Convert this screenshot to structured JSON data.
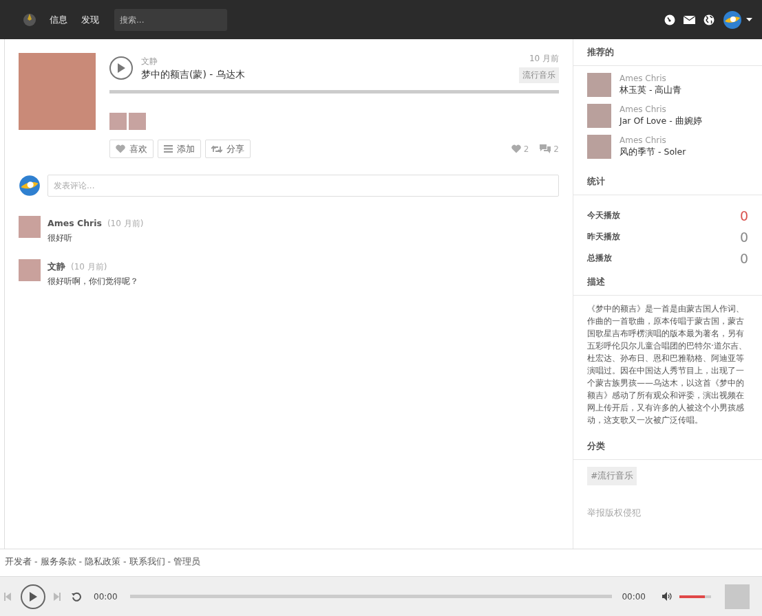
{
  "nav": {
    "items": [
      {
        "label": "信息"
      },
      {
        "label": "发现"
      }
    ],
    "search": {
      "placeholder": "搜索..."
    }
  },
  "track": {
    "artist": "文静",
    "title": "梦中的额吉(蒙) - 乌达木",
    "time": "10 月前",
    "genre": "流行音乐",
    "level": 0,
    "likers": [
      {
        "kind": "photo"
      },
      {
        "kind": "photo"
      }
    ],
    "actions": [
      {
        "kind": "like",
        "label": "喜欢"
      },
      {
        "kind": "add",
        "label": "添加"
      },
      {
        "kind": "share",
        "label": "分享"
      }
    ],
    "likes": "2",
    "comments": "2"
  },
  "comment_box": {
    "placeholder": "发表评论..."
  },
  "comments": [
    {
      "author": "Ames Chris",
      "time": "(10 月前)",
      "text": "很好听"
    },
    {
      "author": "文静",
      "time": "(10 月前)",
      "text": "很好听啊，你们觉得呢？"
    }
  ],
  "sidebar": {
    "recommended": {
      "title": "推荐的",
      "items": [
        {
          "user": "Ames Chris",
          "track": "林玉英 - 高山青"
        },
        {
          "user": "Ames Chris",
          "track": "Jar Of Love - 曲婉婷"
        },
        {
          "user": "Ames Chris",
          "track": "风的季节 - Soler"
        }
      ]
    },
    "stats": {
      "title": "统计",
      "items": [
        {
          "label": "今天播放",
          "value": "0",
          "highlight": true
        },
        {
          "label": "昨天播放",
          "value": "0",
          "highlight": false
        },
        {
          "label": "总播放",
          "value": "0",
          "highlight": false
        }
      ]
    },
    "description": {
      "title": "描述",
      "text": "《梦中的额吉》是一首是由蒙古国人作词、作曲的一首歌曲，原本传唱于蒙古国，蒙古国歌星吉布呼楞演唱的版本最为著名，另有五彩呼伦贝尔儿童合唱团的巴特尔·道尔吉、杜宏达、孙布日、恩和巴雅勒格、阿迪亚等演唱过。因在中国达人秀节目上，出现了一个蒙古族男孩——乌达木，以这首《梦中的额吉》感动了所有观众和评委，演出视频在网上传开后，又有许多的人被这个小男孩感动，这支歌又一次被广泛传唱。"
    },
    "category": {
      "title": "分类",
      "tags": [
        "#流行音乐"
      ]
    },
    "report": "举报版权侵犯"
  },
  "footer": {
    "links": [
      "开发者",
      "服务条款",
      "隐私政策",
      "联系我们",
      "管理员"
    ],
    "separator": "-"
  },
  "player": {
    "elapsed": "00:00",
    "duration": "00:00",
    "level": 0,
    "volume": {
      "level": 0.8
    }
  }
}
